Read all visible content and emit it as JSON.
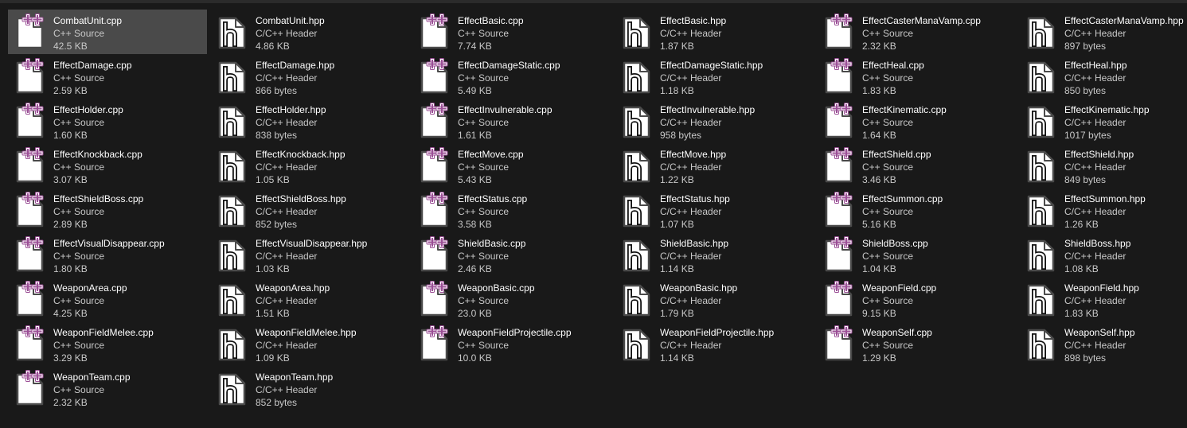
{
  "colors": {
    "background": "#191919",
    "selected": "#4a4a4a",
    "cpp_plus": "#9b4f96",
    "icon_page": "#ffffff",
    "icon_outline": "#4a4a4a"
  },
  "selected_index": 0,
  "files": [
    {
      "name": "CombatUnit.cpp",
      "type": "C++ Source",
      "size": "42.5 KB",
      "icon": "cpp-file-icon"
    },
    {
      "name": "CombatUnit.hpp",
      "type": "C/C++ Header",
      "size": "4.86 KB",
      "icon": "hpp-file-icon"
    },
    {
      "name": "EffectBasic.cpp",
      "type": "C++ Source",
      "size": "7.74 KB",
      "icon": "cpp-file-icon"
    },
    {
      "name": "EffectBasic.hpp",
      "type": "C/C++ Header",
      "size": "1.87 KB",
      "icon": "hpp-file-icon"
    },
    {
      "name": "EffectCasterManaVamp.cpp",
      "type": "C++ Source",
      "size": "2.32 KB",
      "icon": "cpp-file-icon"
    },
    {
      "name": "EffectCasterManaVamp.hpp",
      "type": "C/C++ Header",
      "size": "897 bytes",
      "icon": "hpp-file-icon"
    },
    {
      "name": "EffectDamage.cpp",
      "type": "C++ Source",
      "size": "2.59 KB",
      "icon": "cpp-file-icon"
    },
    {
      "name": "EffectDamage.hpp",
      "type": "C/C++ Header",
      "size": "866 bytes",
      "icon": "hpp-file-icon"
    },
    {
      "name": "EffectDamageStatic.cpp",
      "type": "C++ Source",
      "size": "5.49 KB",
      "icon": "cpp-file-icon"
    },
    {
      "name": "EffectDamageStatic.hpp",
      "type": "C/C++ Header",
      "size": "1.18 KB",
      "icon": "hpp-file-icon"
    },
    {
      "name": "EffectHeal.cpp",
      "type": "C++ Source",
      "size": "1.83 KB",
      "icon": "cpp-file-icon"
    },
    {
      "name": "EffectHeal.hpp",
      "type": "C/C++ Header",
      "size": "850 bytes",
      "icon": "hpp-file-icon"
    },
    {
      "name": "EffectHolder.cpp",
      "type": "C++ Source",
      "size": "1.60 KB",
      "icon": "cpp-file-icon"
    },
    {
      "name": "EffectHolder.hpp",
      "type": "C/C++ Header",
      "size": "838 bytes",
      "icon": "hpp-file-icon"
    },
    {
      "name": "EffectInvulnerable.cpp",
      "type": "C++ Source",
      "size": "1.61 KB",
      "icon": "cpp-file-icon"
    },
    {
      "name": "EffectInvulnerable.hpp",
      "type": "C/C++ Header",
      "size": "958 bytes",
      "icon": "hpp-file-icon"
    },
    {
      "name": "EffectKinematic.cpp",
      "type": "C++ Source",
      "size": "1.64 KB",
      "icon": "cpp-file-icon"
    },
    {
      "name": "EffectKinematic.hpp",
      "type": "C/C++ Header",
      "size": "1017 bytes",
      "icon": "hpp-file-icon"
    },
    {
      "name": "EffectKnockback.cpp",
      "type": "C++ Source",
      "size": "3.07 KB",
      "icon": "cpp-file-icon"
    },
    {
      "name": "EffectKnockback.hpp",
      "type": "C/C++ Header",
      "size": "1.05 KB",
      "icon": "hpp-file-icon"
    },
    {
      "name": "EffectMove.cpp",
      "type": "C++ Source",
      "size": "5.43 KB",
      "icon": "cpp-file-icon"
    },
    {
      "name": "EffectMove.hpp",
      "type": "C/C++ Header",
      "size": "1.22 KB",
      "icon": "hpp-file-icon"
    },
    {
      "name": "EffectShield.cpp",
      "type": "C++ Source",
      "size": "3.46 KB",
      "icon": "cpp-file-icon"
    },
    {
      "name": "EffectShield.hpp",
      "type": "C/C++ Header",
      "size": "849 bytes",
      "icon": "hpp-file-icon"
    },
    {
      "name": "EffectShieldBoss.cpp",
      "type": "C++ Source",
      "size": "2.89 KB",
      "icon": "cpp-file-icon"
    },
    {
      "name": "EffectShieldBoss.hpp",
      "type": "C/C++ Header",
      "size": "852 bytes",
      "icon": "hpp-file-icon"
    },
    {
      "name": "EffectStatus.cpp",
      "type": "C++ Source",
      "size": "3.58 KB",
      "icon": "cpp-file-icon"
    },
    {
      "name": "EffectStatus.hpp",
      "type": "C/C++ Header",
      "size": "1.07 KB",
      "icon": "hpp-file-icon"
    },
    {
      "name": "EffectSummon.cpp",
      "type": "C++ Source",
      "size": "5.16 KB",
      "icon": "cpp-file-icon"
    },
    {
      "name": "EffectSummon.hpp",
      "type": "C/C++ Header",
      "size": "1.26 KB",
      "icon": "hpp-file-icon"
    },
    {
      "name": "EffectVisualDisappear.cpp",
      "type": "C++ Source",
      "size": "1.80 KB",
      "icon": "cpp-file-icon"
    },
    {
      "name": "EffectVisualDisappear.hpp",
      "type": "C/C++ Header",
      "size": "1.03 KB",
      "icon": "hpp-file-icon"
    },
    {
      "name": "ShieldBasic.cpp",
      "type": "C++ Source",
      "size": "2.46 KB",
      "icon": "cpp-file-icon"
    },
    {
      "name": "ShieldBasic.hpp",
      "type": "C/C++ Header",
      "size": "1.14 KB",
      "icon": "hpp-file-icon"
    },
    {
      "name": "ShieldBoss.cpp",
      "type": "C++ Source",
      "size": "1.04 KB",
      "icon": "cpp-file-icon"
    },
    {
      "name": "ShieldBoss.hpp",
      "type": "C/C++ Header",
      "size": "1.08 KB",
      "icon": "hpp-file-icon"
    },
    {
      "name": "WeaponArea.cpp",
      "type": "C++ Source",
      "size": "4.25 KB",
      "icon": "cpp-file-icon"
    },
    {
      "name": "WeaponArea.hpp",
      "type": "C/C++ Header",
      "size": "1.51 KB",
      "icon": "hpp-file-icon"
    },
    {
      "name": "WeaponBasic.cpp",
      "type": "C++ Source",
      "size": "23.0 KB",
      "icon": "cpp-file-icon"
    },
    {
      "name": "WeaponBasic.hpp",
      "type": "C/C++ Header",
      "size": "1.79 KB",
      "icon": "hpp-file-icon"
    },
    {
      "name": "WeaponField.cpp",
      "type": "C++ Source",
      "size": "9.15 KB",
      "icon": "cpp-file-icon"
    },
    {
      "name": "WeaponField.hpp",
      "type": "C/C++ Header",
      "size": "1.83 KB",
      "icon": "hpp-file-icon"
    },
    {
      "name": "WeaponFieldMelee.cpp",
      "type": "C++ Source",
      "size": "3.29 KB",
      "icon": "cpp-file-icon"
    },
    {
      "name": "WeaponFieldMelee.hpp",
      "type": "C/C++ Header",
      "size": "1.09 KB",
      "icon": "hpp-file-icon"
    },
    {
      "name": "WeaponFieldProjectile.cpp",
      "type": "C++ Source",
      "size": "10.0 KB",
      "icon": "cpp-file-icon"
    },
    {
      "name": "WeaponFieldProjectile.hpp",
      "type": "C/C++ Header",
      "size": "1.14 KB",
      "icon": "hpp-file-icon"
    },
    {
      "name": "WeaponSelf.cpp",
      "type": "C++ Source",
      "size": "1.29 KB",
      "icon": "cpp-file-icon"
    },
    {
      "name": "WeaponSelf.hpp",
      "type": "C/C++ Header",
      "size": "898 bytes",
      "icon": "hpp-file-icon"
    },
    {
      "name": "WeaponTeam.cpp",
      "type": "C++ Source",
      "size": "2.32 KB",
      "icon": "cpp-file-icon"
    },
    {
      "name": "WeaponTeam.hpp",
      "type": "C/C++ Header",
      "size": "852 bytes",
      "icon": "hpp-file-icon"
    }
  ]
}
